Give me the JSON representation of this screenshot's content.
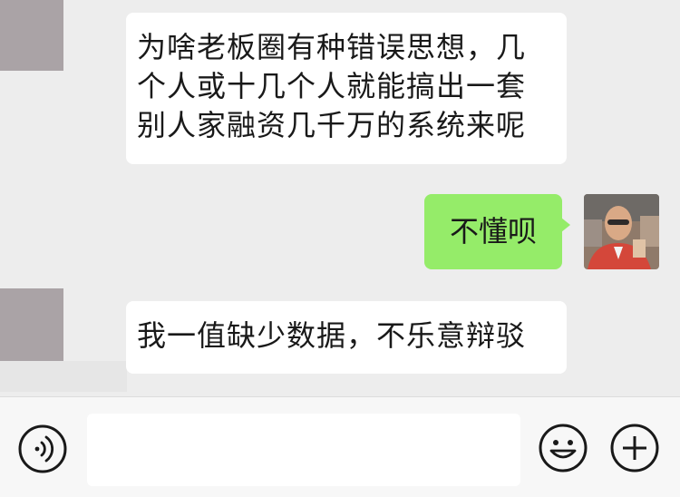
{
  "chat": {
    "messages": [
      {
        "side": "left",
        "lines": [
          "为啥老板圈有种错误思想，几",
          "个人或十几个人就能搞出一套",
          "别人家融资几千万的系统来呢"
        ]
      },
      {
        "side": "right",
        "text": "不懂呗"
      },
      {
        "side": "left",
        "text": "我一值缺少数据，不乐意辩驳"
      }
    ]
  },
  "input_bar": {
    "placeholder": "",
    "voice_icon": "voice-icon",
    "emoji_icon": "emoji-icon",
    "plus_icon": "plus-icon"
  },
  "colors": {
    "background": "#ededed",
    "sent_bubble": "#95ec69",
    "received_bubble": "#ffffff",
    "avatar_placeholder": "#aaa3a6"
  }
}
